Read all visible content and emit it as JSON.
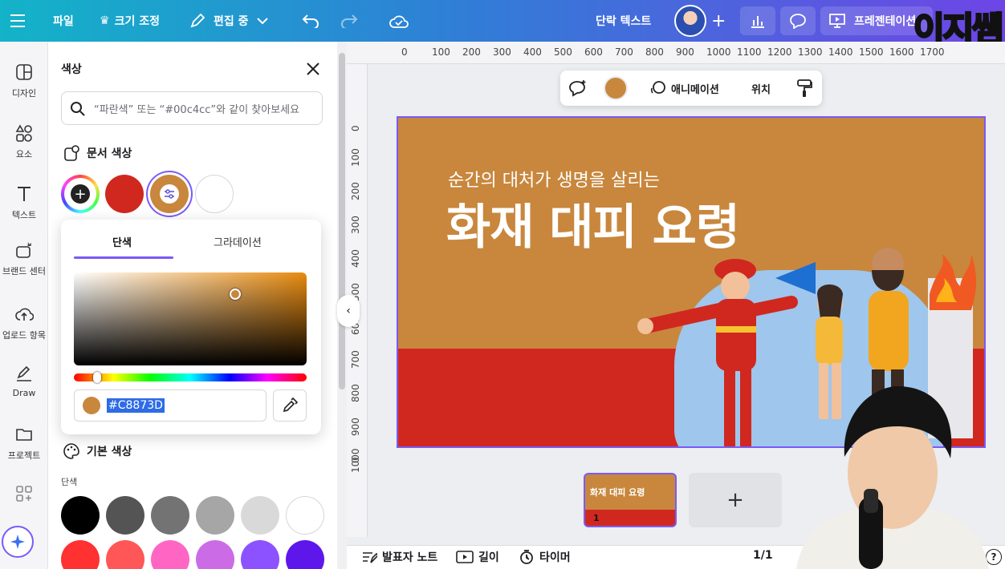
{
  "topbar": {
    "file": "파일",
    "resize": "크기 조정",
    "edit_mode": "편집 중",
    "doc_title": "단락 텍스트",
    "present": "프레젠테이션",
    "watermark": "이지쌤"
  },
  "rail": {
    "items": [
      {
        "label": "디자인",
        "icon": "layout-icon"
      },
      {
        "label": "요소",
        "icon": "shapes-icon"
      },
      {
        "label": "텍스트",
        "icon": "text-icon"
      },
      {
        "label": "브랜드 센터",
        "icon": "brand-icon"
      },
      {
        "label": "업로드 항목",
        "icon": "upload-icon"
      },
      {
        "label": "Draw",
        "icon": "draw-icon"
      },
      {
        "label": "프로젝트",
        "icon": "folder-icon"
      }
    ]
  },
  "panel": {
    "title": "색상",
    "search_placeholder": "“파란색” 또는 “#00c4cc”와 같이 찾아보세요",
    "doc_colors_heading": "문서 색상",
    "doc_colors": [
      "#d0281f",
      "#c8873d",
      "#ffffff"
    ],
    "default_colors_heading": "기본 색상",
    "solid_label": "단색",
    "default_colors_row1": [
      "#000000",
      "#545454",
      "#737373",
      "#a6a6a6",
      "#d9d9d9",
      "#ffffff"
    ],
    "default_colors_row2": [
      "#ff3131",
      "#ff5757",
      "#ff66c4",
      "#cb6ce6",
      "#8c52ff",
      "#5e17eb"
    ]
  },
  "picker": {
    "tab_solid": "단색",
    "tab_gradient": "그라데이션",
    "hex_value": "#C8873D",
    "current_color": "#c8873d",
    "hue_position": 0.1
  },
  "ruler": {
    "top": [
      "0",
      "100",
      "200",
      "300",
      "400",
      "500",
      "600",
      "700",
      "800",
      "900",
      "1000",
      "1100",
      "1200",
      "1300",
      "1400",
      "1500",
      "1600",
      "1700"
    ],
    "left": [
      "0",
      "100",
      "200",
      "300",
      "400",
      "500",
      "600",
      "700",
      "800",
      "900",
      "1000",
      "0"
    ]
  },
  "context_toolbar": {
    "animation": "애니메이션",
    "position": "위치"
  },
  "slide": {
    "subtitle": "순간의 대처가 생명을 살리는",
    "title": "화재 대피 요령",
    "bg_color": "#c8873d",
    "bottom_color": "#d0281f"
  },
  "pages": {
    "thumb_title": "화재 대피 요령",
    "thumb_number": "1",
    "add": "+",
    "counter": "1/1"
  },
  "bottombar": {
    "notes": "발표자 노트",
    "duration": "길이",
    "timer": "타이머",
    "help": "?"
  }
}
